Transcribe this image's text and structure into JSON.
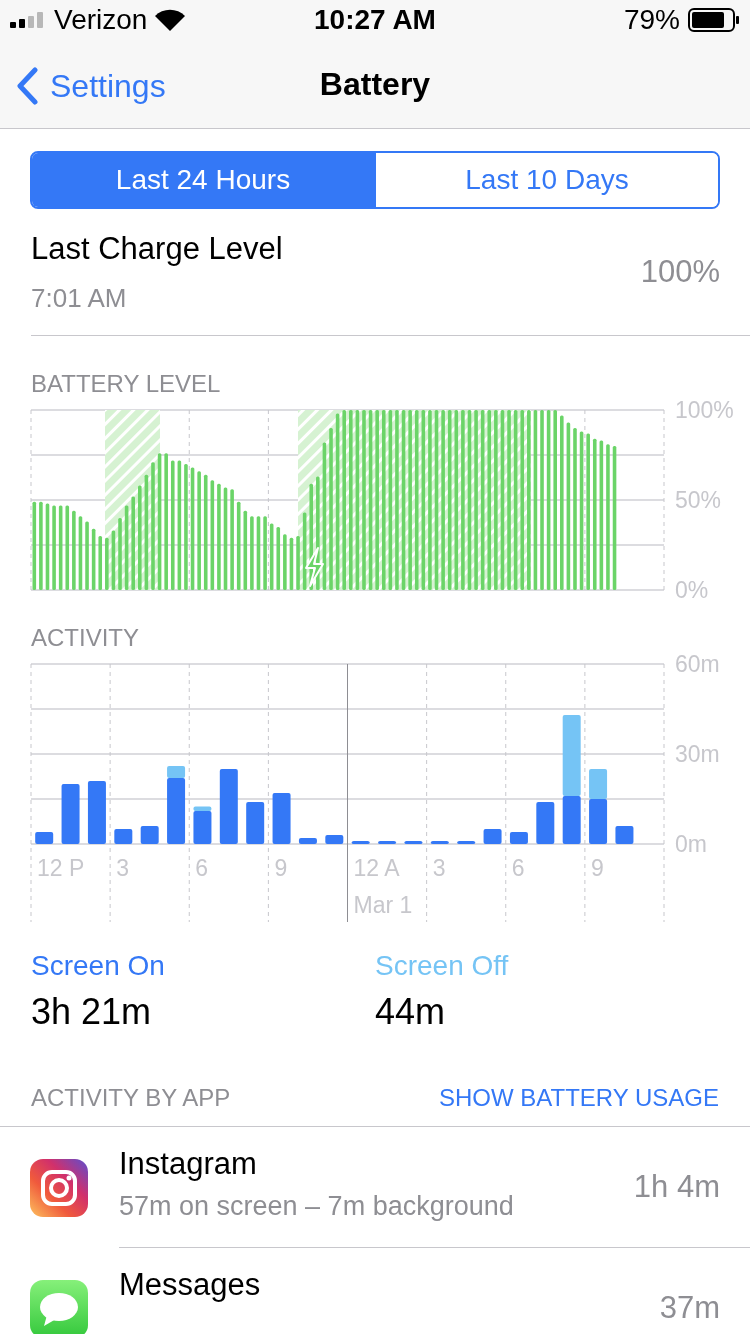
{
  "status_bar": {
    "carrier": "Verizon",
    "time": "10:27 AM",
    "battery": "79%"
  },
  "nav": {
    "back": "Settings",
    "title": "Battery"
  },
  "tabs": [
    {
      "label": "Last 24 Hours",
      "selected": true
    },
    {
      "label": "Last 10 Days",
      "selected": false
    }
  ],
  "last_charge": {
    "label": "Last Charge Level",
    "time": "7:01 AM",
    "value": "100%"
  },
  "battery_level": {
    "chart_data": {
      "type": "bar",
      "title": "BATTERY LEVEL",
      "values": [
        49,
        49,
        48,
        47,
        47,
        47,
        44,
        41,
        38,
        34,
        30,
        29,
        33,
        40,
        47,
        52,
        58,
        64,
        71,
        76,
        76,
        72,
        72,
        70,
        68,
        66,
        64,
        61,
        59,
        57,
        56,
        49,
        44,
        41,
        41,
        41,
        37,
        35,
        31,
        29,
        30,
        43,
        59,
        63,
        82,
        90,
        98,
        100,
        100,
        100,
        100,
        100,
        100,
        100,
        100,
        100,
        100,
        100,
        100,
        100,
        100,
        100,
        100,
        100,
        100,
        100,
        100,
        100,
        100,
        100,
        100,
        100,
        100,
        100,
        100,
        100,
        100,
        100,
        100,
        100,
        97,
        93,
        90,
        88,
        87,
        84,
        83,
        81,
        80,
        null,
        null,
        null,
        null,
        null,
        null,
        null
      ],
      "ylim": [
        0,
        100
      ],
      "yticks": [
        {
          "value": 0,
          "label": "0%"
        },
        {
          "value": 50,
          "label": "50%"
        },
        {
          "value": 100,
          "label": "100%"
        }
      ]
    }
  },
  "activity": {
    "chart_data": {
      "type": "bar",
      "title": "ACTIVITY",
      "stacked": true,
      "series": [
        {
          "name": "Screen On",
          "color": "#3478f6",
          "values": [
            4,
            20,
            21,
            5,
            6,
            22,
            11,
            25,
            14,
            17,
            2,
            3,
            1,
            1,
            1,
            1,
            1,
            5,
            4,
            14,
            16,
            15,
            6
          ]
        },
        {
          "name": "Screen Off",
          "color": "#75c4f5",
          "values": [
            0,
            0,
            0,
            0,
            0,
            4,
            1.5,
            0,
            0,
            0,
            0,
            0,
            0,
            0,
            0,
            0,
            0,
            0,
            0,
            0,
            27,
            10,
            0
          ]
        }
      ],
      "ylim": [
        0,
        60
      ],
      "yticks": [
        {
          "value": 0,
          "label": "0m"
        },
        {
          "value": 30,
          "label": "30m"
        },
        {
          "value": 60,
          "label": "60m"
        }
      ]
    },
    "time_labels": [
      "12 P",
      "3",
      "6",
      "9",
      "12 A",
      "3",
      "6",
      "9"
    ],
    "date_label": "Mar 1"
  },
  "summary": [
    {
      "value": "3h 21m"
    },
    {
      "value": "44m"
    }
  ],
  "apps_header": {
    "title": "ACTIVITY BY APP",
    "action": "SHOW BATTERY USAGE"
  },
  "apps": [
    {
      "kind": "instagram",
      "name": "Instagram",
      "detail": "57m on screen – 7m background",
      "time": "1h 4m"
    },
    {
      "kind": "messages",
      "name": "Messages",
      "time": "37m"
    }
  ]
}
